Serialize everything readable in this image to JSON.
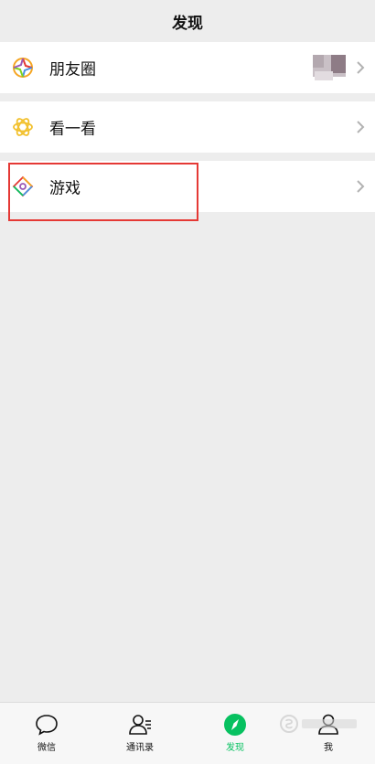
{
  "header": {
    "title": "发现"
  },
  "items": [
    {
      "label": "朋友圈",
      "icon": "moments-icon"
    },
    {
      "label": "看一看",
      "icon": "top-stories-icon"
    },
    {
      "label": "游戏",
      "icon": "games-icon"
    }
  ],
  "tabs": [
    {
      "label": "微信",
      "icon": "chat-icon"
    },
    {
      "label": "通讯录",
      "icon": "contacts-icon"
    },
    {
      "label": "发现",
      "icon": "discover-icon",
      "active": true
    },
    {
      "label": "我",
      "icon": "me-icon"
    }
  ],
  "colors": {
    "accent": "#07c160",
    "highlight": "#e53935",
    "background": "#ededed"
  }
}
